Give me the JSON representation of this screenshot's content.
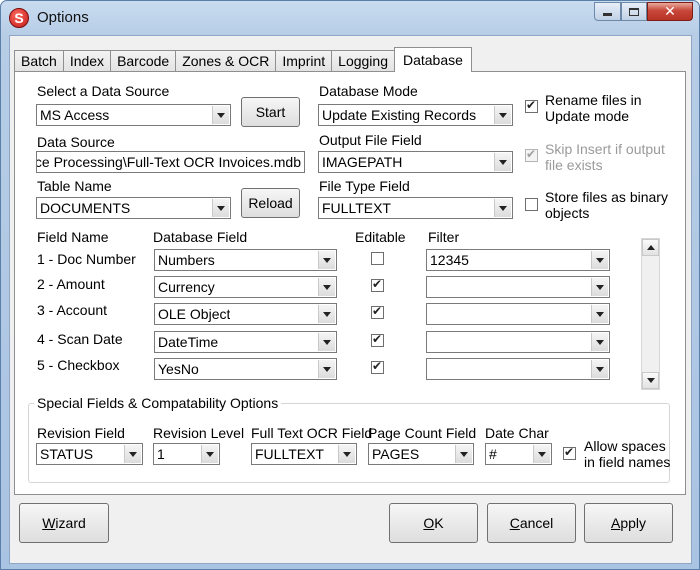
{
  "window": {
    "title": "Options",
    "app_icon": "S"
  },
  "tabs": [
    "Batch",
    "Index",
    "Barcode",
    "Zones & OCR",
    "Imprint",
    "Logging",
    "Database"
  ],
  "active_tab": "Database",
  "data_source": {
    "select_label": "Select a Data Source",
    "select_value": "MS Access",
    "start_button": "Start",
    "path_label": "Data Source",
    "path_value": "C:\\Invoice Processing\\Full-Text OCR Invoices.mdb",
    "table_label": "Table Name",
    "table_value": "DOCUMENTS",
    "reload_button": "Reload"
  },
  "database_mode": {
    "label": "Database Mode",
    "value": "Update Existing Records",
    "output_label": "Output File Field",
    "output_value": "IMAGEPATH",
    "filetype_label": "File Type Field",
    "filetype_value": "FULLTEXT"
  },
  "options": {
    "rename": {
      "label_1": "Rename files in",
      "label_2": "Update mode",
      "checked": true
    },
    "skip": {
      "label_1": "Skip Insert if output",
      "label_2": "file exists",
      "checked": true,
      "disabled": true
    },
    "binary": {
      "label_1": "Store files as binary",
      "label_2": "objects",
      "checked": false
    }
  },
  "fields": {
    "headers": {
      "name": "Field Name",
      "db": "Database Field",
      "editable": "Editable",
      "filter": "Filter"
    },
    "rows": [
      {
        "name": "1 - Doc Number",
        "db": "Numbers",
        "editable": false,
        "filter": "12345"
      },
      {
        "name": "2 - Amount",
        "db": "Currency",
        "editable": true,
        "filter": ""
      },
      {
        "name": "3 - Account",
        "db": "OLE Object",
        "editable": true,
        "filter": ""
      },
      {
        "name": "4 - Scan Date",
        "db": "DateTime",
        "editable": true,
        "filter": ""
      },
      {
        "name": "5 - Checkbox",
        "db": "YesNo",
        "editable": true,
        "filter": ""
      }
    ]
  },
  "special": {
    "group_title": "Special Fields & Compatability Options",
    "revision_field": {
      "label": "Revision Field",
      "value": "STATUS"
    },
    "revision_level": {
      "label": "Revision Level",
      "value": "1"
    },
    "fulltext": {
      "label": "Full Text OCR Field",
      "value": "FULLTEXT"
    },
    "pagecount": {
      "label": "Page Count Field",
      "value": "PAGES"
    },
    "datechar": {
      "label": "Date Char",
      "value": "#"
    },
    "allow_spaces": {
      "label_1": "Allow spaces",
      "label_2": "in field names",
      "checked": true
    }
  },
  "footer": {
    "wizard": {
      "prefix": "",
      "accel": "W",
      "rest": "izard"
    },
    "ok": {
      "prefix": "",
      "accel": "O",
      "rest": "K"
    },
    "cancel": {
      "prefix": "",
      "accel": "C",
      "rest": "ancel"
    },
    "apply": {
      "prefix": "",
      "accel": "A",
      "rest": "pply"
    }
  }
}
